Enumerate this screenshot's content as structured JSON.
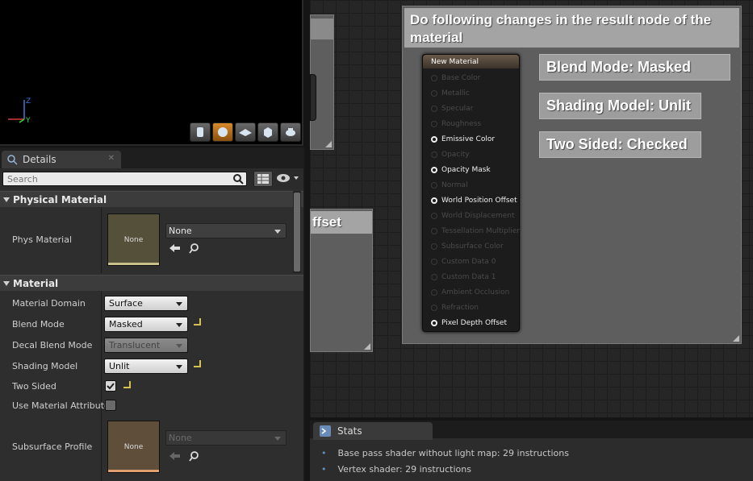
{
  "details": {
    "tab_label": "Details",
    "search_placeholder": "Search",
    "physical_section": "Physical Material",
    "phys_material_label": "Phys Material",
    "phys_thumb_label": "None",
    "phys_combo_value": "None",
    "material_section": "Material",
    "rows": {
      "material_domain": {
        "label": "Material Domain",
        "value": "Surface"
      },
      "blend_mode": {
        "label": "Blend Mode",
        "value": "Masked"
      },
      "decal_blend_mode": {
        "label": "Decal Blend Mode",
        "value": "Translucent"
      },
      "shading_model": {
        "label": "Shading Model",
        "value": "Unlit"
      },
      "two_sided": {
        "label": "Two Sided"
      },
      "use_material_attributes": {
        "label": "Use Material Attribute"
      },
      "subsurface_profile": {
        "label": "Subsurface Profile",
        "thumb": "None",
        "value": "None"
      }
    }
  },
  "graph": {
    "comment_title": "Do following changes in the result node of the material",
    "left_comment_text": "ffset",
    "notes": [
      "Blend Mode: Masked",
      "Shading Model: Unlit",
      "Two Sided: Checked"
    ],
    "node": {
      "title": "New Material",
      "pins": [
        {
          "label": "Base Color",
          "active": false
        },
        {
          "label": "Metallic",
          "active": false
        },
        {
          "label": "Specular",
          "active": false
        },
        {
          "label": "Roughness",
          "active": false
        },
        {
          "label": "Emissive Color",
          "active": true
        },
        {
          "label": "Opacity",
          "active": false
        },
        {
          "label": "Opacity Mask",
          "active": true
        },
        {
          "label": "Normal",
          "active": false
        },
        {
          "label": "World Position Offset",
          "active": true
        },
        {
          "label": "World Displacement",
          "active": false
        },
        {
          "label": "Tessellation Multiplier",
          "active": false
        },
        {
          "label": "Subsurface Color",
          "active": false
        },
        {
          "label": "Custom Data 0",
          "active": false
        },
        {
          "label": "Custom Data 1",
          "active": false
        },
        {
          "label": "Ambient Occlusion",
          "active": false
        },
        {
          "label": "Refraction",
          "active": false
        },
        {
          "label": "Pixel Depth Offset",
          "active": true
        }
      ]
    }
  },
  "stats": {
    "tab_label": "Stats",
    "lines": [
      "Base pass shader without light map: 29 instructions",
      "Vertex shader: 29 instructions"
    ]
  },
  "viewport": {
    "axis_z": "Z",
    "axis_y": "Y",
    "toolbar": [
      "cylinder-icon",
      "sphere-icon",
      "plane-icon",
      "cube-icon",
      "teapot-icon"
    ]
  },
  "colors": {
    "accent_orange": "#d68a2a",
    "reset_yellow": "#d6c24a",
    "stats_bullet": "#5a90d0"
  }
}
